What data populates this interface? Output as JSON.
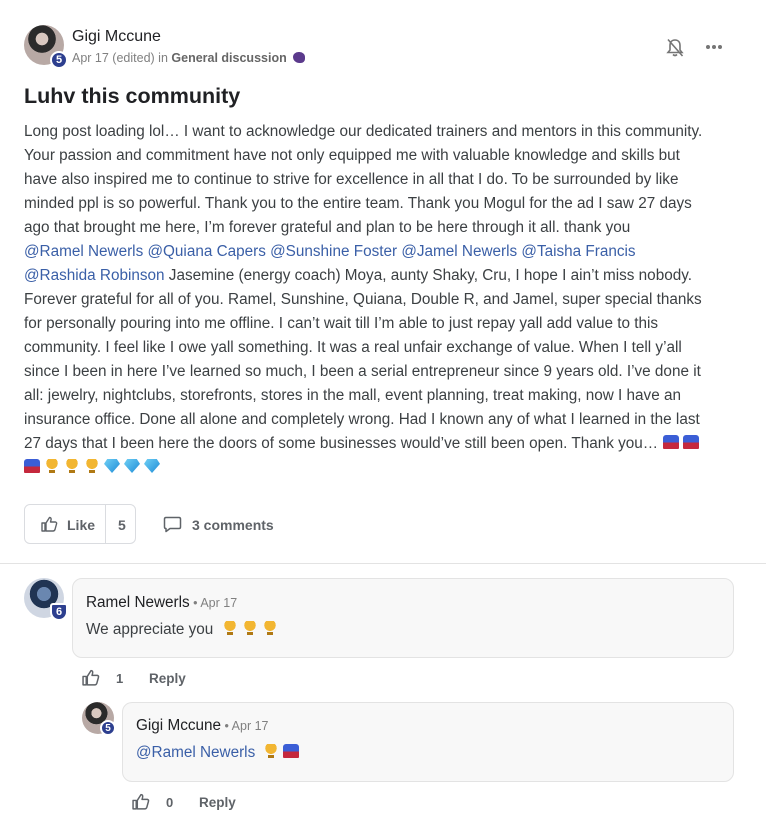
{
  "post": {
    "author": "Gigi Mccune",
    "author_level": "5",
    "date": "Apr 17 (edited)",
    "in_word": "in",
    "category": "General discussion",
    "category_icon": "speaking-head-emoji",
    "title": "Luhv this community",
    "body_lines": [
      "Long post loading lol… I want to acknowledge our dedicated trainers and mentors in this community.",
      "Your passion and commitment have not only equipped me with valuable knowledge and skills but",
      "have also inspired me to continue to strive for excellence in all that I do. To be surrounded by like",
      "minded ppl is so powerful. Thank you to the entire team. Thank you Mogul for the ad I saw 27 days",
      "ago that brought me here, I’m forever grateful and plan to be here through it all. thank you"
    ],
    "mentions_line1": [
      "@Ramel Newerls",
      "@Quiana Capers",
      "@Sunshine Foster",
      "@Jamel Newerls",
      "@Taisha Francis"
    ],
    "mention_line2": "@Rashida Robinson",
    "line2_rest": " Jasemine (energy coach) Moya, aunty Shaky, Cru, I hope I ain’t miss nobody.",
    "body_lines_2": [
      "Forever grateful for all of you. Ramel, Sunshine, Quiana, Double R, and Jamel, super special thanks",
      "for personally pouring into me offline. I can’t wait till I’m able to just repay yall add value to this",
      "community. I feel like I owe yall something. It was a real unfair exchange of value. When I tell y’all",
      "since I been in here I’ve learned so much, I been a serial entrepreneur since 9 years old. I’ve done it",
      "all: jewelry, nightclubs, storefronts, stores in the mall, event planning, treat making, now I have an",
      "insurance office. Done all alone and completely wrong. Had I known any of what I learned in the last"
    ],
    "last_line": "27 days that I been here the doors of some businesses would’ve still been open. Thank you…",
    "end_emojis": [
      "mailbox-emoji",
      "mailbox-emoji",
      "mailbox-emoji",
      "trophy-emoji",
      "trophy-emoji",
      "trophy-emoji",
      "gem-emoji",
      "gem-emoji",
      "gem-emoji"
    ],
    "like_label": "Like",
    "like_count": "5",
    "comments_label": "3 comments"
  },
  "comments": [
    {
      "author": "Ramel Newerls",
      "level": "6",
      "date": "Apr 17",
      "text": "We appreciate you",
      "emojis": [
        "trophy-emoji",
        "trophy-emoji",
        "trophy-emoji"
      ],
      "likes": "1",
      "reply_label": "Reply"
    },
    {
      "author": "Gigi Mccune",
      "level": "5",
      "date": "Apr 17",
      "mention": "@Ramel Newerls",
      "emojis": [
        "trophy-emoji",
        "mailbox-emoji"
      ],
      "likes": "0",
      "reply_label": "Reply"
    }
  ],
  "separator": " • ",
  "colors": {
    "mention": "#3a5fa7",
    "badge": "#2d3f8f",
    "bubble": "#f8f8f8"
  }
}
